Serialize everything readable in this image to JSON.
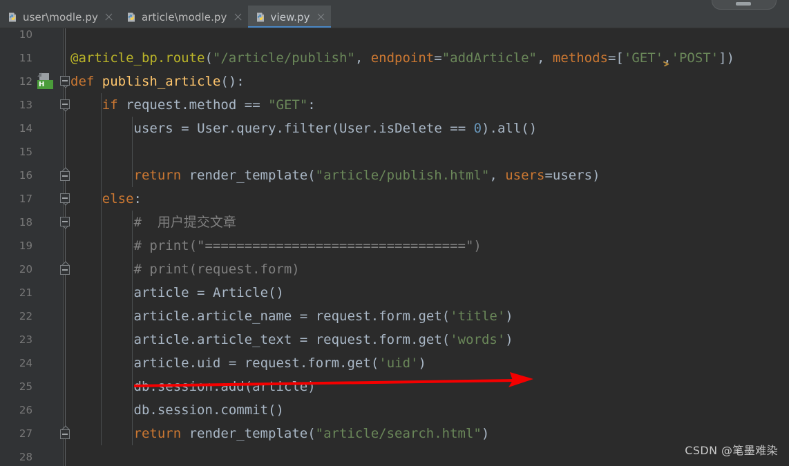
{
  "window": {
    "theme_background": "#2b2b2b",
    "chrome_background": "#3c3f41",
    "accent": "#4a88c7"
  },
  "tabbar": {
    "tabs": [
      {
        "label": "user\\modle.py",
        "icon": "python-file-icon",
        "active": false,
        "close_icon": "close-icon"
      },
      {
        "label": "article\\modle.py",
        "icon": "python-file-icon",
        "active": false,
        "close_icon": "close-icon"
      },
      {
        "label": "view.py",
        "icon": "python-file-icon",
        "active": true,
        "close_icon": "close-icon"
      }
    ]
  },
  "gutter": {
    "line_numbers": [
      "10",
      "11",
      "12",
      "13",
      "14",
      "15",
      "16",
      "17",
      "18",
      "19",
      "20",
      "21",
      "22",
      "23",
      "24",
      "25",
      "26",
      "27",
      "28"
    ],
    "run_marker": {
      "line": "12",
      "badge": "H",
      "badge_color": "#4a9c3a",
      "icon": "page-with-badge-icon"
    },
    "fold_markers": [
      {
        "line": "12",
        "direction": "down"
      },
      {
        "line": "13",
        "direction": "down"
      },
      {
        "line": "16",
        "direction": "up"
      },
      {
        "line": "17",
        "direction": "down"
      },
      {
        "line": "18",
        "direction": "down"
      },
      {
        "line": "20",
        "direction": "up"
      },
      {
        "line": "27",
        "direction": "up"
      }
    ],
    "left_markers": [
      {
        "color": "#2b4b6b",
        "name": "changed-lines-marker"
      },
      {
        "color": "#4e4a33",
        "name": "search-result-marker"
      }
    ]
  },
  "editor": {
    "filename": "view.py",
    "language": "python",
    "lines": [
      {
        "n": "10",
        "text": ""
      },
      {
        "n": "11",
        "text": "@article_bp.route(\"/article/publish\", endpoint=\"addArticle\", methods=['GET','POST'])"
      },
      {
        "n": "12",
        "text": "def publish_article():"
      },
      {
        "n": "13",
        "text": "    if request.method == \"GET\":"
      },
      {
        "n": "14",
        "text": "        users = User.query.filter(User.isDelete == 0).all()"
      },
      {
        "n": "15",
        "text": ""
      },
      {
        "n": "16",
        "text": "        return render_template(\"article/publish.html\", users=users)"
      },
      {
        "n": "17",
        "text": "    else:"
      },
      {
        "n": "18",
        "text": "        #  用户提交文章"
      },
      {
        "n": "19",
        "text": "        # print(\"=================================\")"
      },
      {
        "n": "20",
        "text": "        # print(request.form)"
      },
      {
        "n": "21",
        "text": "        article = Article()"
      },
      {
        "n": "22",
        "text": "        article.article_name = request.form.get('title')"
      },
      {
        "n": "23",
        "text": "        article.article_text = request.form.get('words')"
      },
      {
        "n": "24",
        "text": "        article.uid = request.form.get('uid')"
      },
      {
        "n": "25",
        "text": "        db.session.add(article)"
      },
      {
        "n": "26",
        "text": "        db.session.commit()"
      },
      {
        "n": "27",
        "text": "        return render_template(\"article/search.html\")"
      },
      {
        "n": "28",
        "text": ""
      }
    ]
  },
  "annotations": {
    "arrow": {
      "color": "#f40000",
      "name": "red-annotation-arrow",
      "from_line": "25",
      "to_line": "25"
    },
    "caret": {
      "name": "text-caret",
      "line": "11"
    }
  },
  "watermark": {
    "text": "CSDN @笔墨难染"
  }
}
